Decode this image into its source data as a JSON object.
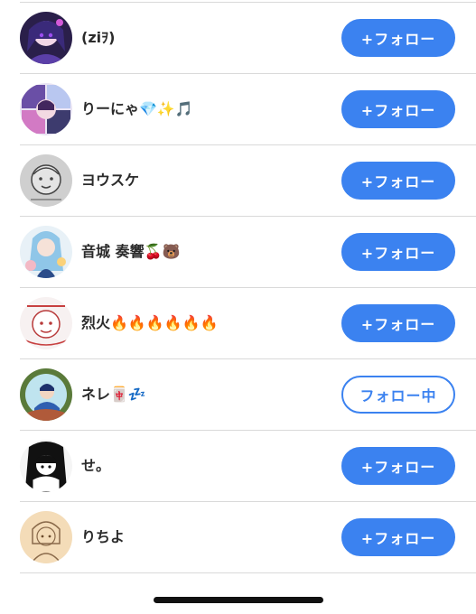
{
  "users": [
    {
      "name": "(ziｦ)",
      "button": "+フォロー",
      "following": false,
      "avatar": "anime-girl-purple-avatar"
    },
    {
      "name": "りーにゃ💎✨🎵",
      "button": "+フォロー",
      "following": false,
      "avatar": "anime-character-collage-avatar"
    },
    {
      "name": "ヨウスケ",
      "button": "+フォロー",
      "following": false,
      "avatar": "sketch-doodle-avatar"
    },
    {
      "name": "音城 奏響🍒🐻",
      "button": "+フォロー",
      "following": false,
      "avatar": "anime-blue-hair-avatar"
    },
    {
      "name": "烈火🔥🔥🔥🔥🔥🔥",
      "button": "+フォロー",
      "following": false,
      "avatar": "red-sketch-avatar"
    },
    {
      "name": "ネレ🀄💤",
      "button": "フォロー中",
      "following": true,
      "avatar": "anime-boy-avatar"
    },
    {
      "name": "せ。",
      "button": "+フォロー",
      "following": false,
      "avatar": "manga-girl-avatar"
    },
    {
      "name": "りちよ",
      "button": "+フォロー",
      "following": false,
      "avatar": "pencil-girl-avatar"
    }
  ],
  "colors": {
    "accent": "#3b82f0",
    "divider": "#d9d9d9",
    "text": "#2b2b2b"
  }
}
